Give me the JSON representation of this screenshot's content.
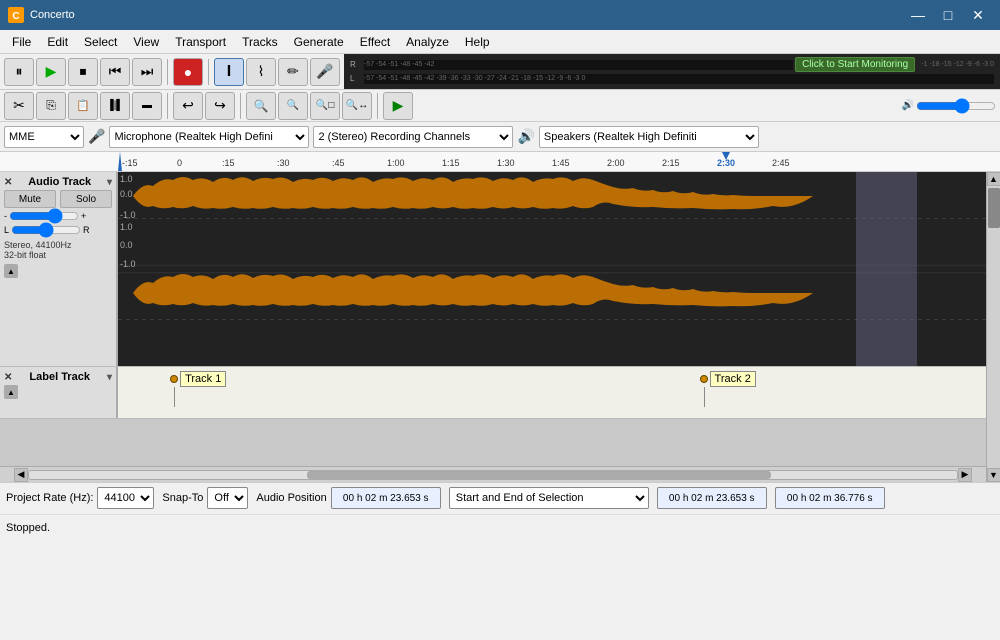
{
  "app": {
    "title": "Concerto",
    "icon": "C"
  },
  "titlebar": {
    "minimize_label": "—",
    "maximize_label": "□",
    "close_label": "✕"
  },
  "menubar": {
    "items": [
      "File",
      "Edit",
      "Select",
      "View",
      "Transport",
      "Tracks",
      "Generate",
      "Effect",
      "Analyze",
      "Help"
    ]
  },
  "transport": {
    "pause_label": "⏸",
    "play_label": "▶",
    "stop_label": "⏹",
    "skip_start_label": "⏮",
    "skip_end_label": "⏭",
    "record_label": "●"
  },
  "tools": {
    "selection_label": "I",
    "envelope_label": "⏦",
    "draw_label": "✏",
    "mic_label": "🎤",
    "zoom_label": "🔍",
    "resize_label": "↔",
    "multitool_label": "✳",
    "speaker_label": "🔊"
  },
  "vu": {
    "monitor_btn": "Click to Start Monitoring",
    "row1_label": "R",
    "row2_label": "L",
    "scale": "-57 -54 -51 -48 -45 -42",
    "scale2": "-57 -54 -51 -48 -45 -42 -39 -36 -33 -30 -27 -24 -21 -18 -15 -12 -9 -6 -3 0"
  },
  "toolbar2": {
    "cut_label": "✂",
    "copy_label": "⎘",
    "paste_label": "📋",
    "trim_label": "▐▌",
    "silence_label": "▬",
    "undo_label": "↩",
    "redo_label": "↪",
    "zoom_in_label": "🔍+",
    "zoom_out_label": "🔍-",
    "zoom_sel_label": "🔍▢",
    "zoom_fit_label": "🔍↔",
    "play_green_label": "▶"
  },
  "mixer": {
    "device": "MME",
    "microphone": "Microphone (Realtek High Defini",
    "channels": "2 (Stereo) Recording Channels",
    "speaker": "Speakers (Realtek High Definiti"
  },
  "ruler": {
    "marks": [
      "-:15",
      "0",
      ":15",
      ":30",
      ":45",
      "1:00",
      "1:15",
      "1:30",
      "1:45",
      "2:00",
      "2:15",
      "2:30",
      "2:45"
    ],
    "playhead": "2:30"
  },
  "audio_track": {
    "name": "Audio Track",
    "close_label": "✕",
    "dropdown_label": "▾",
    "mute_label": "Mute",
    "solo_label": "Solo",
    "volume_min": "-",
    "volume_max": "+",
    "pan_left": "L",
    "pan_right": "R",
    "info": "Stereo, 44100Hz\n32-bit float",
    "collapse_label": "▲"
  },
  "label_track": {
    "name": "Label Track",
    "close_label": "✕",
    "dropdown_label": "▾",
    "collapse_label": "▲",
    "labels": [
      {
        "text": "Track 1",
        "left_pct": 6
      },
      {
        "text": "Track 2",
        "left_pct": 67
      }
    ]
  },
  "statusbar": {
    "project_rate_label": "Project Rate (Hz):",
    "project_rate_value": "44100",
    "snap_to_label": "Snap-To",
    "snap_to_value": "Off",
    "audio_position_label": "Audio Position",
    "audio_position_value": "00 h 02 m 23.653 s",
    "selection_start": "00 h 02 m 23.653 s",
    "selection_end": "00 h 02 m 36.776 s",
    "selection_mode": "Start and End of Selection",
    "status_text": "Stopped."
  }
}
